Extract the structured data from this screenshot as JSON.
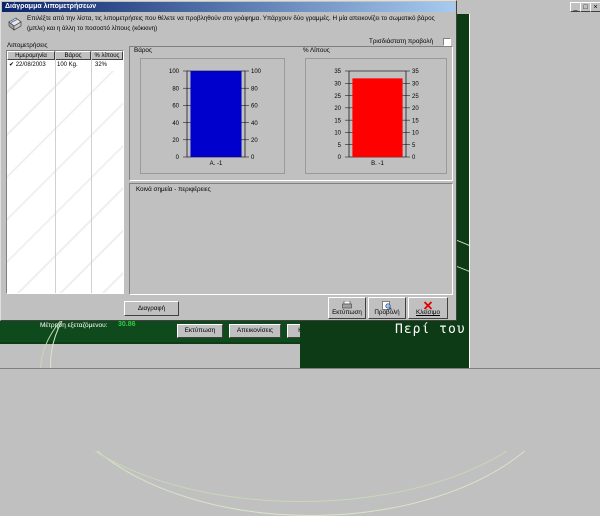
{
  "dialog": {
    "title": "Διάγραμμα λιπομετρήσεων",
    "instructions": "Επιλέξτε από την λίστα, τις λιπομετρήσεις που θέλετε να προβληθούν στο γράφημα. Υπάρχουν δύο γραμμές. Η μία απεικονίζει το σωματικό βάρος (μπλε) και η άλλη το ποσοστό λίπους (κόκκινη)",
    "three_d_label": "Τρισδιάστατη προβολή",
    "three_d_checked": false,
    "list_label": "Λιπομετρήσεις",
    "columns": [
      "Ημερομηνία",
      "Βάρος",
      "% λίπους"
    ],
    "rows": [
      {
        "checked": true,
        "date": "22/08/2003",
        "weight": "100 Kg.",
        "fat": "32%"
      }
    ],
    "common_points_label": "Κοινά σημεία - περιφέρειες",
    "buttons": {
      "delete": "Διαγραφή",
      "print": "Εκτύπωση",
      "preview": "Προβολή",
      "close": "Κλείσιμο"
    }
  },
  "chart_data": [
    {
      "type": "bar",
      "title": "Βάρος",
      "categories": [
        "A. -1"
      ],
      "values": [
        100
      ],
      "ylim": [
        0,
        100
      ],
      "yticks": [
        0,
        20,
        40,
        60,
        80,
        100
      ],
      "color": "#0000cc",
      "grid": true
    },
    {
      "type": "bar",
      "title": "% Λίπους",
      "categories": [
        "B. -1"
      ],
      "values": [
        32
      ],
      "ylim": [
        0,
        35
      ],
      "yticks": [
        0,
        5,
        10,
        15,
        20,
        25,
        30,
        35
      ],
      "color": "#ff0000",
      "grid": true
    }
  ],
  "background": {
    "measure_label": "Μέτρηση εξεταζόμενου:",
    "measure_value": "30.86",
    "buttons": [
      "Εκτύπωση",
      "Απεικονίσεις",
      "Κλείσιμο"
    ],
    "banner_text": "Περί του",
    "window_buttons": [
      "_",
      "□",
      "×"
    ]
  }
}
